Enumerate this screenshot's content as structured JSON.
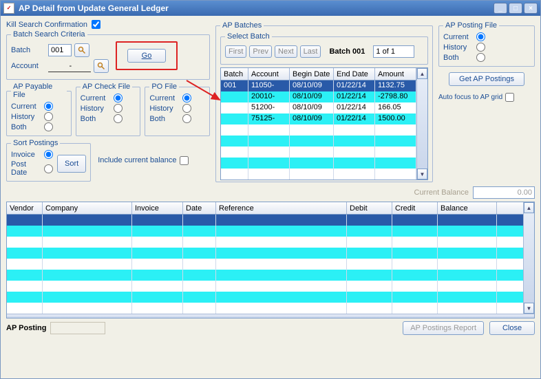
{
  "window": {
    "title": "AP Detail from Update General Ledger"
  },
  "kill": {
    "label": "Kill Search Confirmation",
    "checked": true
  },
  "batchSearch": {
    "legend": "Batch Search Criteria",
    "batchLabel": "Batch",
    "batchValue": "001",
    "accountLabel": "Account",
    "accountValue": "         -",
    "goLabel": "Go"
  },
  "payableFile": {
    "legend": "AP Payable File",
    "opts": [
      "Current",
      "History",
      "Both"
    ],
    "selected": 0
  },
  "checkFile": {
    "legend": "AP Check File",
    "opts": [
      "Current",
      "History",
      "Both"
    ],
    "selected": 0
  },
  "poFile": {
    "legend": "PO File",
    "opts": [
      "Current",
      "History",
      "Both"
    ],
    "selected": 0
  },
  "sortPostings": {
    "legend": "Sort Postings",
    "opts": [
      "Invoice",
      "Post Date"
    ],
    "selected": 0,
    "sortLabel": "Sort"
  },
  "includeBalance": {
    "label": "Include current balance",
    "checked": false
  },
  "apBatches": {
    "legend": "AP Batches",
    "selectBatchLegend": "Select Batch",
    "nav": [
      "First",
      "Prev",
      "Next",
      "Last"
    ],
    "batchBold": "Batch 001",
    "batchPage": "1 of 1",
    "cols": [
      "Batch",
      "Account",
      "Begin Date",
      "End Date",
      "Amount"
    ],
    "rows": [
      {
        "batch": "001",
        "account": "11050-",
        "begin": "08/10/09",
        "end": "01/22/14",
        "amount": "1132.75",
        "selected": true
      },
      {
        "batch": "",
        "account": "20010-",
        "begin": "08/10/09",
        "end": "01/22/14",
        "amount": "-2798.80"
      },
      {
        "batch": "",
        "account": "51200-",
        "begin": "08/10/09",
        "end": "01/22/14",
        "amount": "166.05"
      },
      {
        "batch": "",
        "account": "75125-",
        "begin": "08/10/09",
        "end": "01/22/14",
        "amount": "1500.00"
      }
    ]
  },
  "postingFile": {
    "legend": "AP Posting File",
    "opts": [
      "Current",
      "History",
      "Both"
    ],
    "selected": 0,
    "getBtn": "Get AP Postings",
    "autoFocusLabel": "Auto focus to AP grid",
    "autoFocusChecked": false
  },
  "currentBalance": {
    "label": "Current Balance",
    "value": "0.00"
  },
  "detailGrid": {
    "cols": [
      "Vendor",
      "Company",
      "Invoice",
      "Date",
      "Reference",
      "Debit",
      "Credit",
      "Balance"
    ]
  },
  "footer": {
    "apPostingLabel": "AP Posting",
    "apPostingValue": "",
    "reportBtn": "AP Postings Report",
    "closeBtn": "Close"
  }
}
